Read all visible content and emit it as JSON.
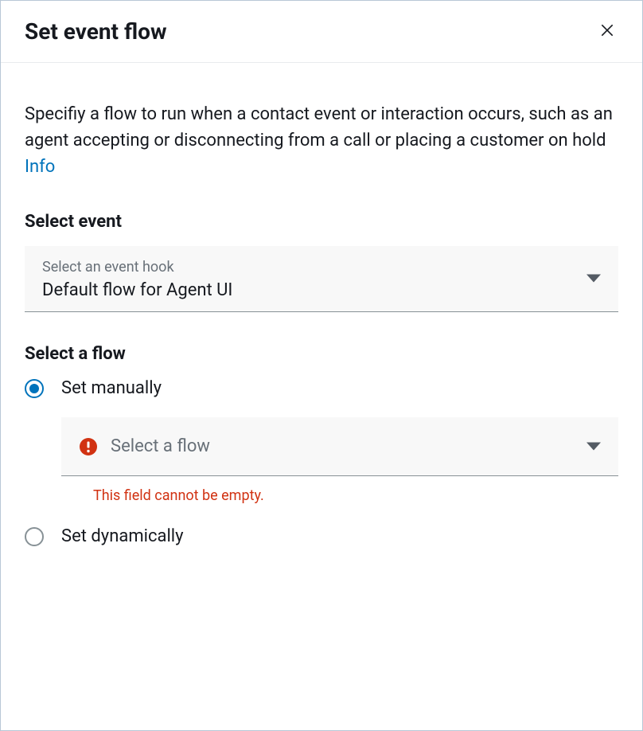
{
  "dialog": {
    "title": "Set event flow"
  },
  "description": {
    "text": "Specifiy a flow to run when a contact event or interaction occurs, such as an agent accepting or disconnecting from a call or placing a customer on hold ",
    "info_link": "Info"
  },
  "event_section": {
    "label": "Select event",
    "sub_label": "Select an event hook",
    "value": "Default flow for Agent UI"
  },
  "flow_section": {
    "label": "Select a flow",
    "radios": {
      "manually": "Set manually",
      "dynamically": "Set dynamically"
    },
    "flow_placeholder": "Select a flow",
    "error": "This field cannot be empty."
  }
}
